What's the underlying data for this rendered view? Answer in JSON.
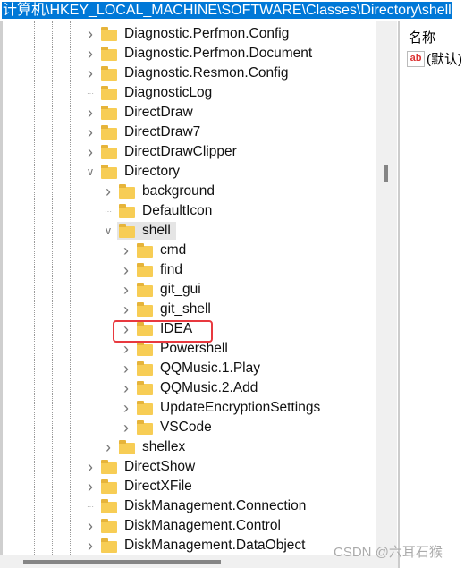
{
  "address_bar": {
    "path": "计算机\\HKEY_LOCAL_MACHINE\\SOFTWARE\\Classes\\Directory\\shell"
  },
  "tree": {
    "items": [
      {
        "label": "Diagnostic.Perfmon.Config",
        "level": 0,
        "chevron": "right"
      },
      {
        "label": "Diagnostic.Perfmon.Document",
        "level": 0,
        "chevron": "right"
      },
      {
        "label": "Diagnostic.Resmon.Config",
        "level": 0,
        "chevron": "right"
      },
      {
        "label": "DiagnosticLog",
        "level": 0,
        "chevron": "none"
      },
      {
        "label": "DirectDraw",
        "level": 0,
        "chevron": "right"
      },
      {
        "label": "DirectDraw7",
        "level": 0,
        "chevron": "right"
      },
      {
        "label": "DirectDrawClipper",
        "level": 0,
        "chevron": "right"
      },
      {
        "label": "Directory",
        "level": 0,
        "chevron": "down"
      },
      {
        "label": "background",
        "level": 1,
        "chevron": "right"
      },
      {
        "label": "DefaultIcon",
        "level": 1,
        "chevron": "none"
      },
      {
        "label": "shell",
        "level": 1,
        "chevron": "down",
        "selected": true
      },
      {
        "label": "cmd",
        "level": 2,
        "chevron": "right"
      },
      {
        "label": "find",
        "level": 2,
        "chevron": "right"
      },
      {
        "label": "git_gui",
        "level": 2,
        "chevron": "right"
      },
      {
        "label": "git_shell",
        "level": 2,
        "chevron": "right"
      },
      {
        "label": "IDEA",
        "level": 2,
        "chevron": "right",
        "highlighted": true
      },
      {
        "label": "Powershell",
        "level": 2,
        "chevron": "right"
      },
      {
        "label": "QQMusic.1.Play",
        "level": 2,
        "chevron": "right"
      },
      {
        "label": "QQMusic.2.Add",
        "level": 2,
        "chevron": "right"
      },
      {
        "label": "UpdateEncryptionSettings",
        "level": 2,
        "chevron": "right"
      },
      {
        "label": "VSCode",
        "level": 2,
        "chevron": "right"
      },
      {
        "label": "shellex",
        "level": 1,
        "chevron": "right"
      },
      {
        "label": "DirectShow",
        "level": 0,
        "chevron": "right"
      },
      {
        "label": "DirectXFile",
        "level": 0,
        "chevron": "right"
      },
      {
        "label": "DiskManagement.Connection",
        "level": 0,
        "chevron": "none"
      },
      {
        "label": "DiskManagement.Control",
        "level": 0,
        "chevron": "right"
      },
      {
        "label": "DiskManagement.DataObject",
        "level": 0,
        "chevron": "right"
      }
    ]
  },
  "values_pane": {
    "header": "名称",
    "rows": [
      {
        "icon": "string-value-icon",
        "icon_text": "ab",
        "name": "(默认)"
      }
    ]
  },
  "highlight_color": "#e8393f",
  "watermark": "CSDN @六耳石猴"
}
